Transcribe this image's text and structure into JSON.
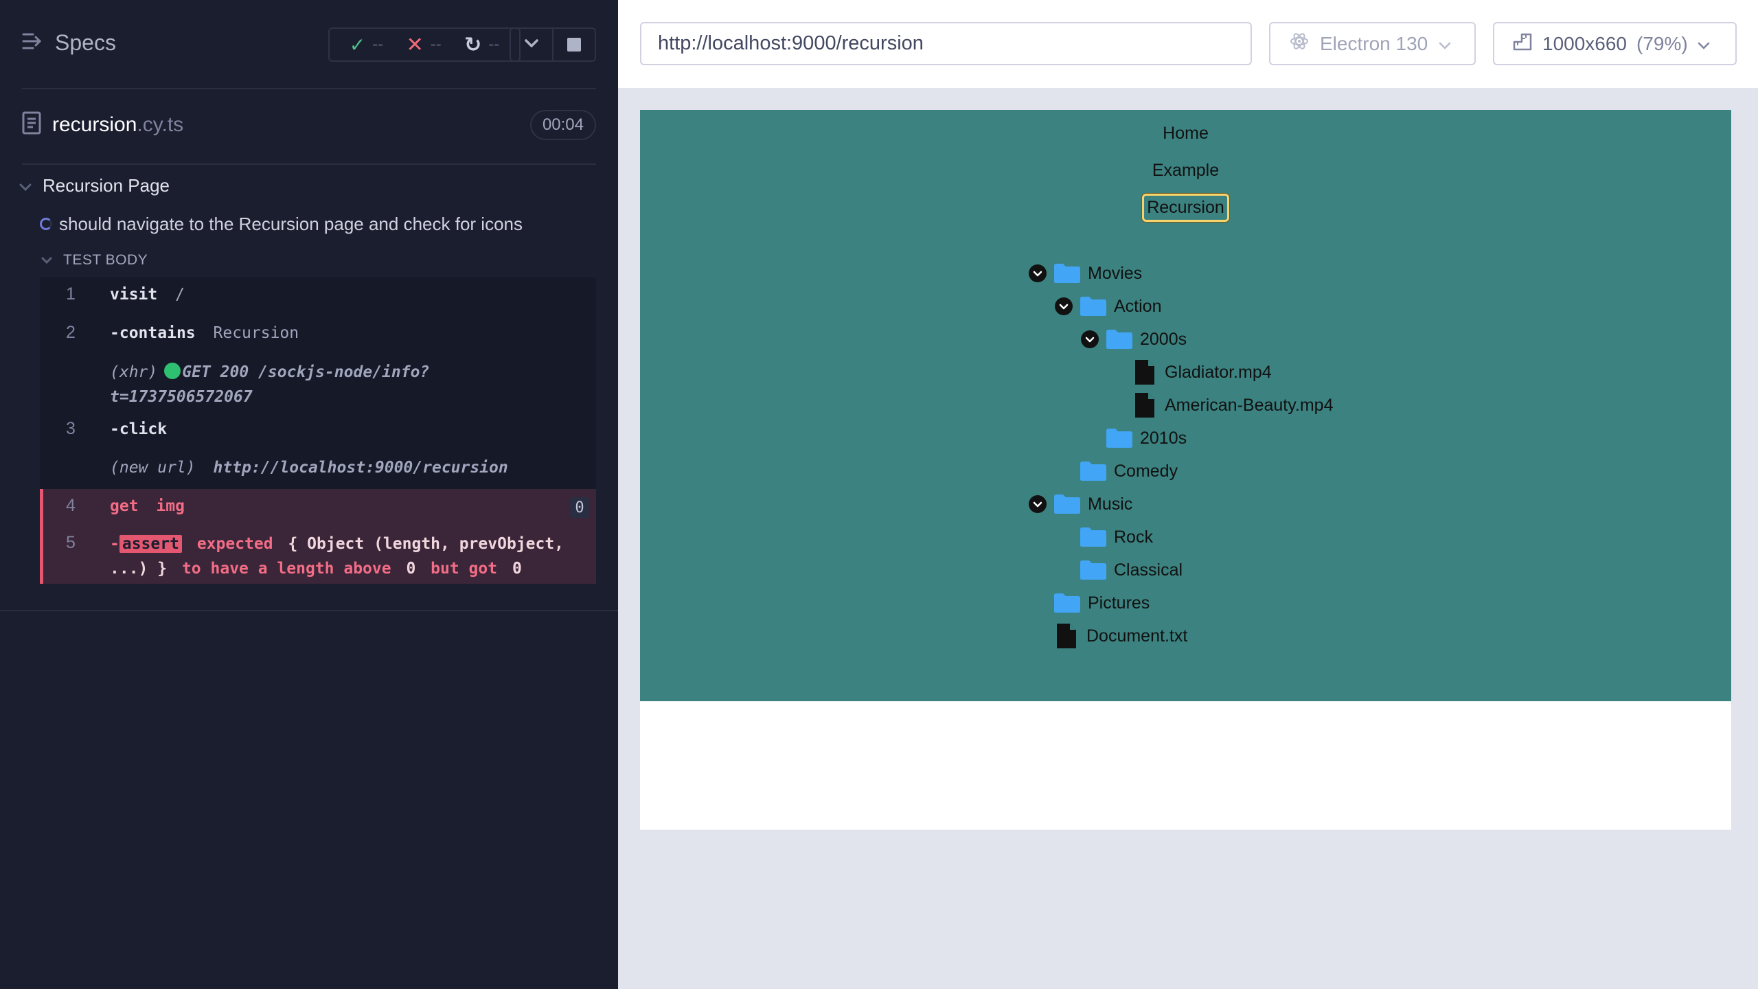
{
  "reporter": {
    "specs_label": "Specs",
    "stats": {
      "passed": "--",
      "failed": "--",
      "pending": "--"
    },
    "spec": {
      "name": "recursion",
      "ext": ".cy.ts",
      "duration": "00:04"
    },
    "suite_title": "Recursion Page",
    "test_title": "should navigate to the Recursion page and check for icons",
    "test_body_label": "TEST BODY",
    "commands": [
      {
        "num": "1",
        "name": "visit",
        "arg": "/"
      },
      {
        "num": "2",
        "name": "contains",
        "arg": "Recursion"
      },
      {
        "num": "",
        "log_label": "(xhr)",
        "log_text": "GET 200 /sockjs-node/info?",
        "log_text2": "t=1737506572067"
      },
      {
        "num": "3",
        "name": "click"
      },
      {
        "num": "",
        "log_label": "(new url)",
        "log_text": "http://localhost:9000/recursion"
      },
      {
        "num": "4",
        "name": "get",
        "arg": "img",
        "count": "0"
      },
      {
        "num": "5",
        "name": "assert",
        "w1": "expected",
        "w2": "{ Object (length, prevObject,",
        "w3": "...) }",
        "w4": "to have a length above",
        "w5": "0",
        "w6": "but got",
        "w7": "0"
      }
    ]
  },
  "aut": {
    "url": "http://localhost:9000/recursion",
    "browser": "Electron 130",
    "viewport": "1000x660",
    "zoom": "(79%)",
    "nav": [
      "Home",
      "Example",
      "Recursion"
    ],
    "tree": [
      {
        "label": "Movies",
        "type": "folder",
        "expanded": true
      },
      {
        "label": "Action",
        "type": "folder",
        "expanded": true
      },
      {
        "label": "2000s",
        "type": "folder",
        "expanded": true
      },
      {
        "label": "Gladiator.mp4",
        "type": "file"
      },
      {
        "label": "American-Beauty.mp4",
        "type": "file"
      },
      {
        "label": "2010s",
        "type": "folder"
      },
      {
        "label": "Comedy",
        "type": "folder"
      },
      {
        "label": "Music",
        "type": "folder",
        "expanded": true
      },
      {
        "label": "Rock",
        "type": "folder"
      },
      {
        "label": "Classical",
        "type": "folder"
      },
      {
        "label": "Pictures",
        "type": "folder"
      },
      {
        "label": "Document.txt",
        "type": "file"
      }
    ]
  },
  "colors": {
    "teal": "#3b8280",
    "folder": "#42a5f5",
    "fail": "#e45770",
    "pass": "#4dc18b"
  }
}
